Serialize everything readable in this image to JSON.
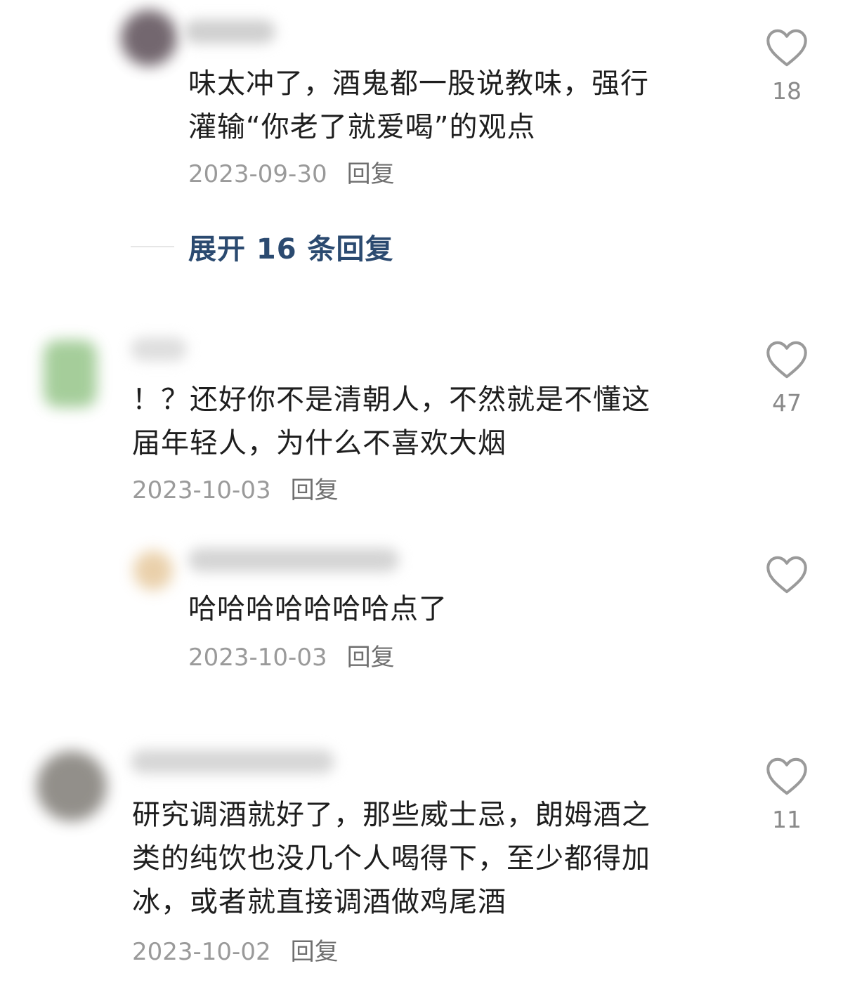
{
  "colors": {
    "text": "#1e1e1e",
    "meta": "#9a9a9a",
    "expand": "#2b4a70"
  },
  "comments": [
    {
      "text": "味太冲了，酒鬼都一股说教味，强行\n灌输“你老了就爱喝”的观点",
      "date": "2023-09-30",
      "reply_label": "回复",
      "likes": "18",
      "avatar_color": "#5b4d56",
      "is_reply": true
    },
    {
      "text": "！？还好你不是清朝人，不然就是不懂这\n届年轻人，为什么不喜欢大烟",
      "date": "2023-10-03",
      "reply_label": "回复",
      "likes": "47",
      "avatar_color": "#7fb970",
      "is_reply": false
    },
    {
      "text": "哈哈哈哈哈哈哈点了",
      "date": "2023-10-03",
      "reply_label": "回复",
      "likes": "",
      "avatar_color": "#e6c89c",
      "is_reply": true
    },
    {
      "text": "研究调酒就好了，那些威士忌，朗姆酒之\n类的纯饮也没几个人喝得下，至少都得加\n冰，或者就直接调酒做鸡尾酒",
      "date": "2023-10-02",
      "reply_label": "回复",
      "likes": "11",
      "avatar_color": "#6e6a63",
      "is_reply": false
    }
  ],
  "expand_replies": "展开 16 条回复",
  "icons": {
    "like": "heart-outline-icon"
  }
}
